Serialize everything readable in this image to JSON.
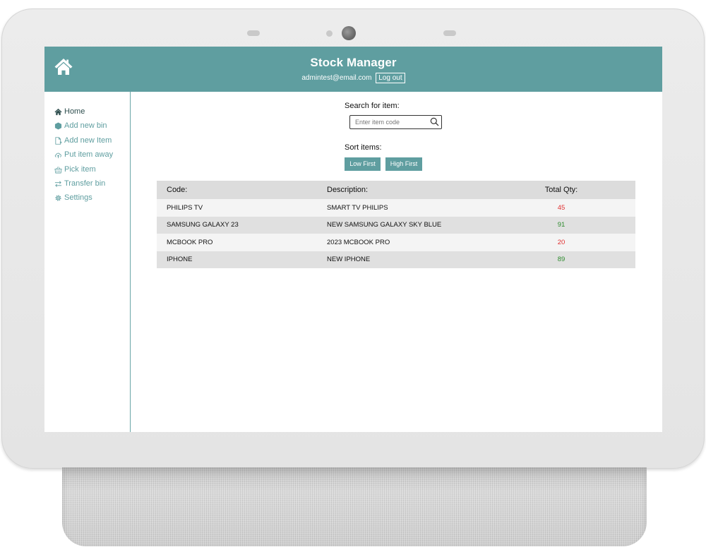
{
  "header": {
    "title": "Stock Manager",
    "user_email": "admintest@email.com",
    "logout_label": "Log out",
    "home_icon": "home-icon",
    "color": "#5f9ea0"
  },
  "sidebar": {
    "items": [
      {
        "label": "Home",
        "icon": "home-icon",
        "active": true
      },
      {
        "label": "Add new bin",
        "icon": "hexagon-icon",
        "active": false
      },
      {
        "label": "Add new Item",
        "icon": "file-plus-icon",
        "active": false
      },
      {
        "label": "Put item away",
        "icon": "cloud-upload-icon",
        "active": false
      },
      {
        "label": "Pick item",
        "icon": "basket-icon",
        "active": false
      },
      {
        "label": "Transfer bin",
        "icon": "transfer-arrows-icon",
        "active": false
      },
      {
        "label": "Settings",
        "icon": "gear-icon",
        "active": false
      }
    ]
  },
  "search": {
    "label": "Search for item:",
    "placeholder": "Enter item code",
    "value": ""
  },
  "sort": {
    "label": "Sort items:",
    "low_label": "Low First",
    "high_label": "High First"
  },
  "table": {
    "columns": [
      "Code:",
      "Description:",
      "Total Qty:"
    ],
    "rows": [
      {
        "code": "PHILIPS TV",
        "description": "SMART TV PHILIPS",
        "qty": "45",
        "status": "low"
      },
      {
        "code": "SAMSUNG GALAXY 23",
        "description": "NEW SAMSUNG GALAXY SKY BLUE",
        "qty": "91",
        "status": "high"
      },
      {
        "code": "MCBOOK PRO",
        "description": "2023 MCBOOK PRO",
        "qty": "20",
        "status": "low"
      },
      {
        "code": "IPHONE",
        "description": "NEW IPHONE",
        "qty": "89",
        "status": "high"
      }
    ],
    "colors": {
      "low": "#e03030",
      "high": "#2e8b2e"
    }
  }
}
